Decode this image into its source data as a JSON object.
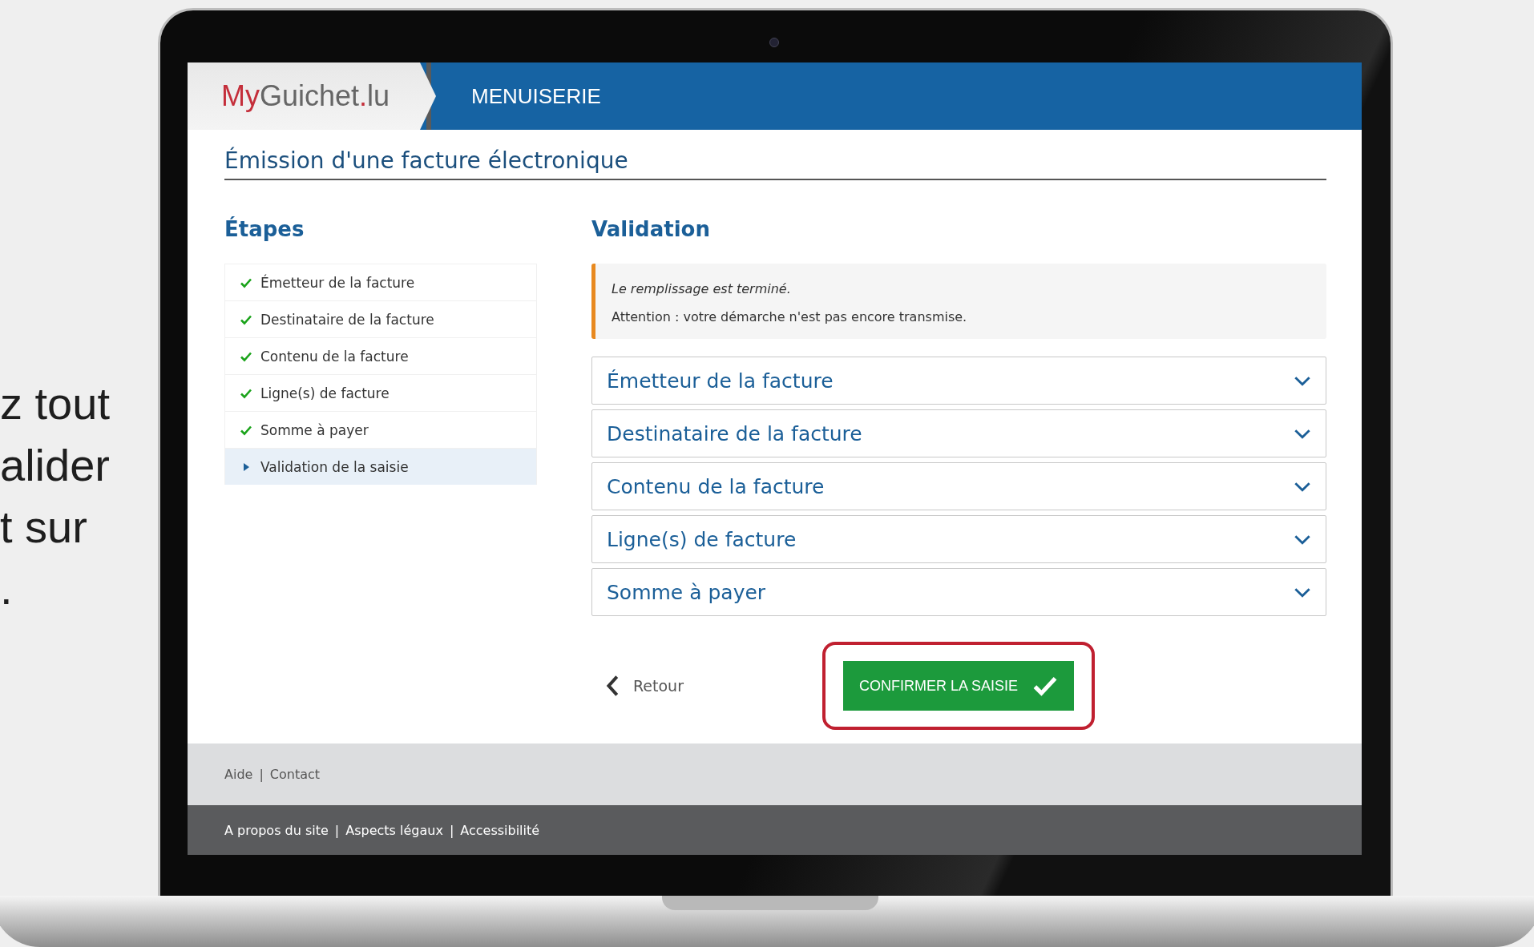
{
  "side_text": {
    "lines": [
      "z tout",
      "alider",
      "t sur",
      "."
    ]
  },
  "header": {
    "logo_parts": [
      {
        "text": "My",
        "kind": "accent"
      },
      {
        "text": "Guichet",
        "kind": "plain"
      },
      {
        "text": ".",
        "kind": "accent"
      },
      {
        "text": "lu",
        "kind": "plain"
      }
    ],
    "section": "MENUISERIE"
  },
  "page_title": "Émission d'une facture électronique",
  "steps": {
    "heading": "Étapes",
    "items": [
      {
        "label": "Émetteur de la facture",
        "completed": true,
        "selected": false
      },
      {
        "label": "Destinataire de la facture",
        "completed": true,
        "selected": false
      },
      {
        "label": "Contenu de la facture",
        "completed": true,
        "selected": false
      },
      {
        "label": "Ligne(s) de facture",
        "completed": true,
        "selected": false
      },
      {
        "label": "Somme à payer",
        "completed": true,
        "selected": false
      },
      {
        "label": "Validation de la saisie",
        "completed": false,
        "selected": true
      }
    ]
  },
  "validation": {
    "heading": "Validation",
    "notice": {
      "status": "Le remplissage est terminé.",
      "warning": "Attention : votre démarche n'est pas encore transmise."
    },
    "sections": [
      {
        "title": "Émetteur de la facture",
        "expanded": false
      },
      {
        "title": "Destinataire de la facture",
        "expanded": false
      },
      {
        "title": "Contenu de la facture",
        "expanded": false
      },
      {
        "title": "Ligne(s) de facture",
        "expanded": false
      },
      {
        "title": "Somme à payer",
        "expanded": false
      }
    ],
    "back_link": "Retour",
    "confirm_button": "CONFIRMER LA SAISIE",
    "highlighted": true
  },
  "footer": {
    "separator": "|",
    "links": [
      "Aide",
      "Contact"
    ],
    "bottom_links": [
      "A propos du site",
      "Aspects légaux",
      "Accessibilité"
    ]
  }
}
